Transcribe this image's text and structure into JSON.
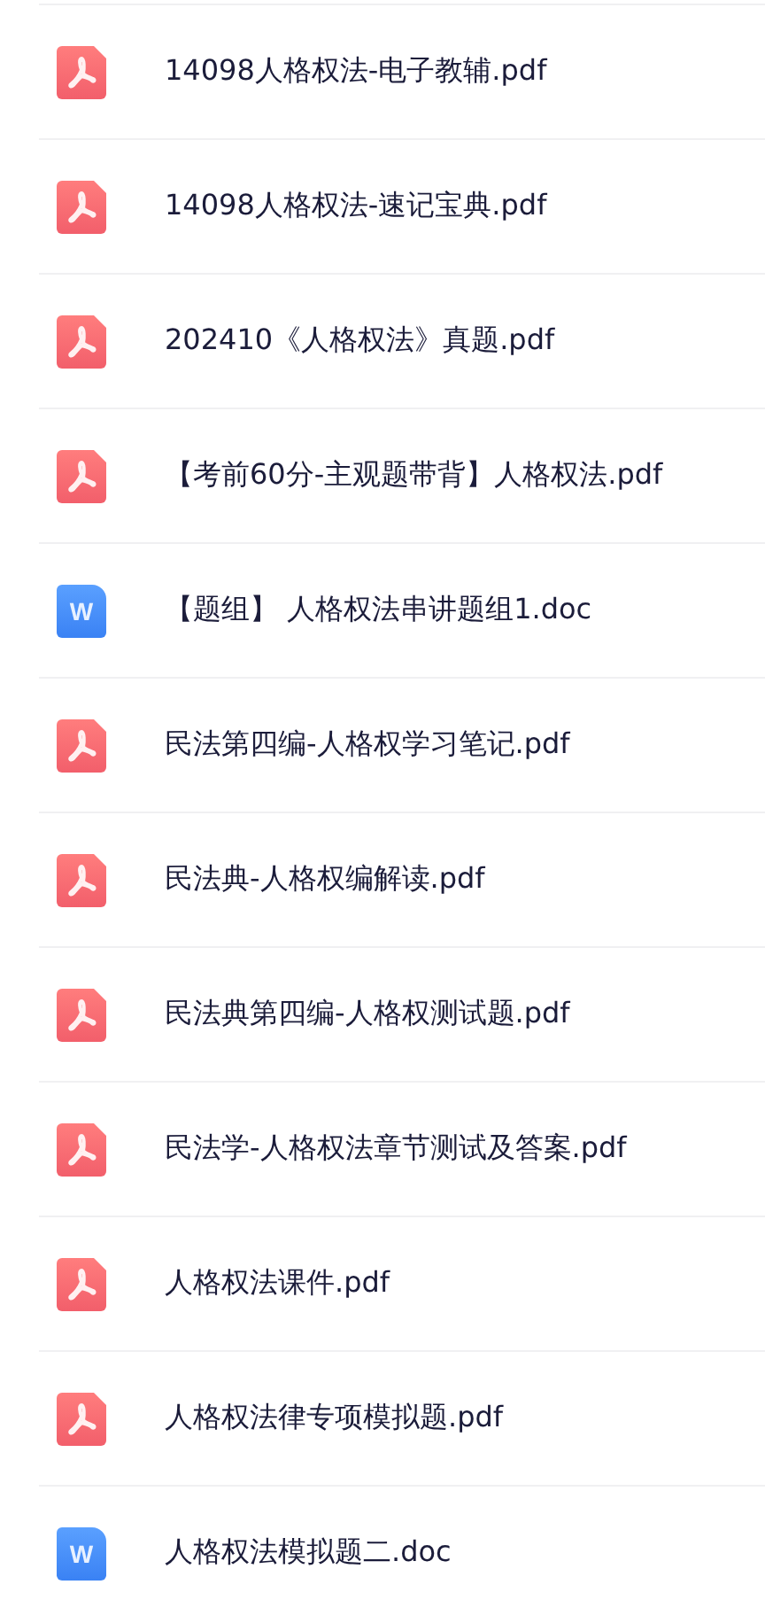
{
  "files": [
    {
      "kind": "pdf",
      "name": "14098人格权法-电子教辅.pdf"
    },
    {
      "kind": "pdf",
      "name": "14098人格权法-速记宝典.pdf"
    },
    {
      "kind": "pdf",
      "name": "202410《人格权法》真题.pdf"
    },
    {
      "kind": "pdf",
      "name": "【考前60分-主观题带背】人格权法.pdf"
    },
    {
      "kind": "doc",
      "icon_letter": "W",
      "name": "【题组】 人格权法串讲题组1.doc"
    },
    {
      "kind": "pdf",
      "name": "民法第四编-人格权学习笔记.pdf"
    },
    {
      "kind": "pdf",
      "name": "民法典-人格权编解读.pdf"
    },
    {
      "kind": "pdf",
      "name": "民法典第四编-人格权测试题.pdf"
    },
    {
      "kind": "pdf",
      "name": "民法学-人格权法章节测试及答案.pdf"
    },
    {
      "kind": "pdf",
      "name": "人格权法课件.pdf"
    },
    {
      "kind": "pdf",
      "name": "人格权法律专项模拟题.pdf"
    },
    {
      "kind": "doc",
      "icon_letter": "W",
      "name": "人格权法模拟题二.doc"
    }
  ]
}
